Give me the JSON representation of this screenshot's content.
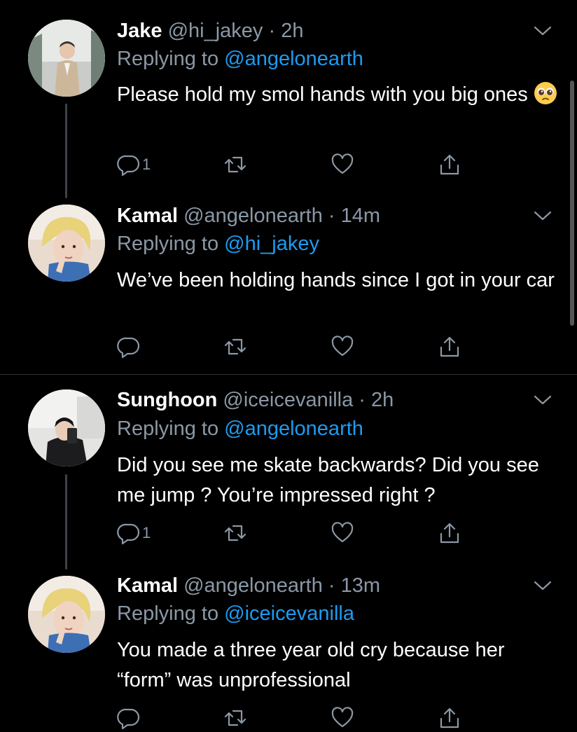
{
  "tweets": [
    {
      "name": "Jake",
      "handle": "@hi_jakey",
      "time": "2h",
      "replying_label": "Replying to",
      "replying_to": "@angelonearth",
      "text": "Please hold my smol hands with you big ones",
      "emoji": "pleading-face-emoji",
      "reply_count": "1"
    },
    {
      "name": "Kamal",
      "handle": "@angelonearth",
      "time": "14m",
      "replying_label": "Replying to",
      "replying_to": "@hi_jakey",
      "text": "We’ve been holding hands since I got in your car",
      "reply_count": ""
    },
    {
      "name": "Sunghoon",
      "handle": "@iceicevanilla",
      "time": "2h",
      "replying_label": "Replying to",
      "replying_to": "@angelonearth",
      "text": "Did you see me skate backwards? Did you see me jump ? You’re impressed right ?",
      "reply_count": "1"
    },
    {
      "name": "Kamal",
      "handle": "@angelonearth",
      "time": "13m",
      "replying_label": "Replying to",
      "replying_to": "@iceicevanilla",
      "text": "You made a three year old cry because her “form” was unprofessional",
      "reply_count": ""
    }
  ],
  "separator": " · ",
  "icons": {
    "reply": "reply-icon",
    "retweet": "retweet-icon",
    "like": "heart-icon",
    "share": "share-icon",
    "more": "chevron-down-icon"
  },
  "colors": {
    "background": "#000000",
    "text": "#ffffff",
    "secondary": "#8b98a5",
    "link": "#1d9bf0"
  }
}
